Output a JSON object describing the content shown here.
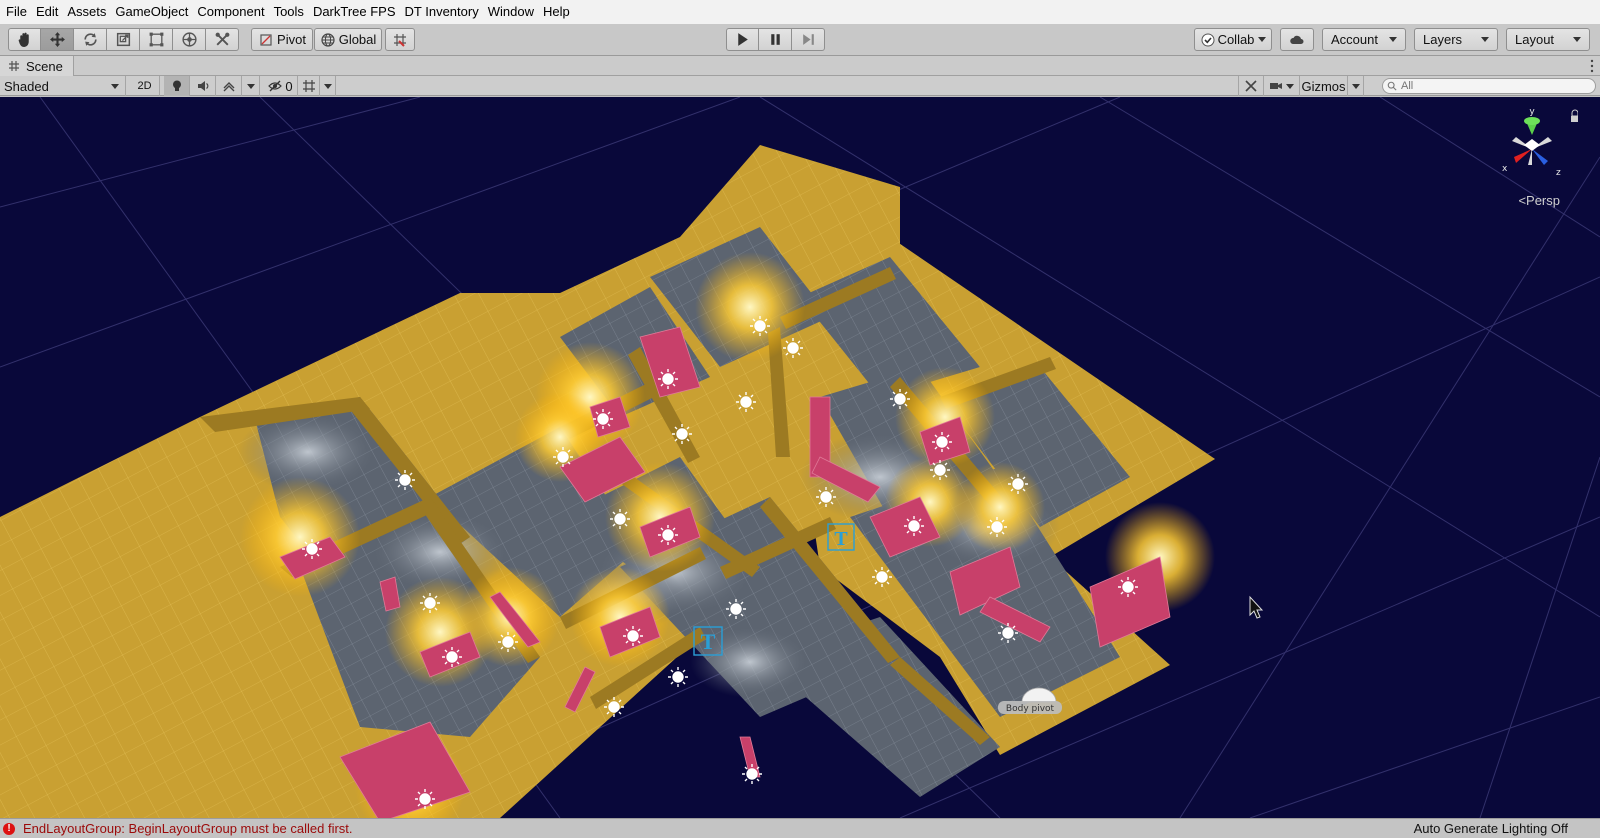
{
  "menu": [
    "File",
    "Edit",
    "Assets",
    "GameObject",
    "Component",
    "Tools",
    "DarkTree FPS",
    "DT Inventory",
    "Window",
    "Help"
  ],
  "toolbar": {
    "tools": [
      {
        "name": "hand-tool",
        "icon": "hand-icon"
      },
      {
        "name": "move-tool",
        "icon": "move-icon"
      },
      {
        "name": "rotate-tool",
        "icon": "rotate-icon"
      },
      {
        "name": "scale-tool",
        "icon": "scale-icon"
      },
      {
        "name": "rect-tool",
        "icon": "rect-transform-icon"
      },
      {
        "name": "transform-tool",
        "icon": "transform-icon"
      },
      {
        "name": "custom-tool",
        "icon": "custom-tool-icon"
      }
    ],
    "pivot_label": "Pivot",
    "global_label": "Global",
    "collab_label": "Collab",
    "account_label": "Account",
    "layers_label": "Layers",
    "layout_label": "Layout"
  },
  "scene_tab": {
    "label": "Scene"
  },
  "scene_controls": {
    "draw_mode": "Shaded",
    "mode_2d": "2D",
    "hidden_count": "0",
    "gizmos_label": "Gizmos",
    "search_placeholder": "All"
  },
  "viewport": {
    "projection_label": "Persp",
    "axis_labels": {
      "x": "x",
      "y": "y",
      "z": "z"
    },
    "object_label": "Body pivot",
    "marker_letter": "T"
  },
  "status": {
    "error_message": "EndLayoutGroup: BeginLayoutGroup must be called first.",
    "lighting": "Auto Generate Lighting Off"
  },
  "colors": {
    "sky": "#09083a",
    "grid": "#4a4a78",
    "wall": "#c9a032",
    "wall_dark": "#8f6f1c",
    "floor": "#5d6570",
    "furniture": "#c8406a",
    "light_glow": "#ffd84a",
    "error": "#9b0a0a"
  }
}
